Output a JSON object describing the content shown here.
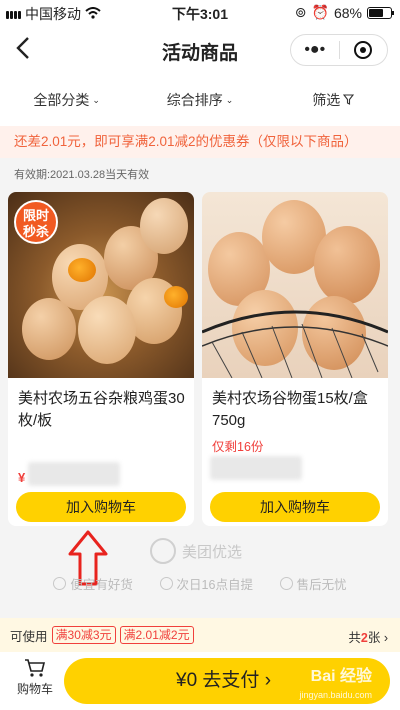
{
  "status_bar": {
    "carrier": "中国移动",
    "time": "下午3:01",
    "battery": "68%",
    "battery_level": 0.68
  },
  "nav": {
    "title": "活动商品"
  },
  "filters": [
    {
      "label": "全部分类",
      "icon": "chevron-down-icon"
    },
    {
      "label": "综合排序",
      "icon": "chevron-down-icon"
    },
    {
      "label": "筛选",
      "icon": "filter-icon"
    }
  ],
  "promo_banner": "还差2.01元，即可享满2.01减2的优惠券（仅限以下商品）",
  "validity": "有效期:2021.03.28当天有效",
  "products": [
    {
      "badge": "限时\n秒杀",
      "title": "美村农场五谷杂粮鸡蛋30枚/板",
      "price_symbol": "¥",
      "add_to_cart": "加入购物车"
    },
    {
      "title": "美村农场谷物蛋15枚/盒750g",
      "stock": "仅剩16份",
      "add_to_cart": "加入购物车"
    }
  ],
  "brand": "美团优选",
  "guarantees": [
    "便宜有好货",
    "次日16点自提",
    "售后无忧"
  ],
  "coupons": {
    "label": "可使用",
    "tags": [
      "满30减3元",
      "满2.01减2元"
    ],
    "count_prefix": "共",
    "count": "2",
    "count_suffix": "张",
    "chevron": "›"
  },
  "bottom": {
    "cart_label": "购物车",
    "pay_label": "¥0  去支付 ›"
  },
  "watermark": {
    "text": "Bai 经验",
    "sub": "jingyan.baidu.com"
  },
  "colors": {
    "accent": "#ffd100",
    "price_red": "#f0403c",
    "promo": "#f0633c"
  }
}
